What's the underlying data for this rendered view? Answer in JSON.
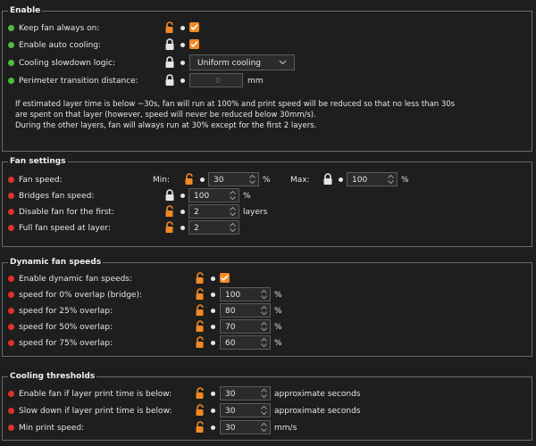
{
  "enable": {
    "title": "Enable",
    "keep_fan": {
      "label": "Keep fan always on:"
    },
    "auto_cooling": {
      "label": "Enable auto cooling:"
    },
    "slowdown": {
      "label": "Cooling slowdown logic:",
      "value": "Uniform cooling"
    },
    "perimeter": {
      "label": "Perimeter transition distance:",
      "value": "0",
      "unit": "mm"
    },
    "description": [
      "If estimated layer time is below ~30s, fan will run at 100% and print speed will be reduced so that no less than 30s",
      "are spent on that layer (however, speed will never be reduced below 30mm/s).",
      "During the other layers, fan will always run at 30% except for the first 2 layers."
    ]
  },
  "fan_settings": {
    "title": "Fan settings",
    "fan_speed": {
      "label": "Fan speed:",
      "min_label": "Min:",
      "min_value": "30",
      "min_unit": "%",
      "max_label": "Max:",
      "max_value": "100",
      "max_unit": "%"
    },
    "bridges": {
      "label": "Bridges fan speed:",
      "value": "100",
      "unit": "%"
    },
    "disable_first": {
      "label": "Disable fan for the first:",
      "value": "2",
      "unit": "layers"
    },
    "full_speed": {
      "label": "Full fan speed at layer:",
      "value": "2"
    }
  },
  "dynamic": {
    "title": "Dynamic fan speeds",
    "enable": {
      "label": "Enable dynamic fan speeds:"
    },
    "rows": [
      {
        "label": "speed for 0% overlap (bridge):",
        "value": "100",
        "unit": "%"
      },
      {
        "label": "speed for 25% overlap:",
        "value": "80",
        "unit": "%"
      },
      {
        "label": "speed for 50% overlap:",
        "value": "70",
        "unit": "%"
      },
      {
        "label": "speed for 75% overlap:",
        "value": "60",
        "unit": "%"
      }
    ]
  },
  "thresholds": {
    "title": "Cooling thresholds",
    "rows": [
      {
        "label": "Enable fan if layer print time is below:",
        "value": "30",
        "unit": "approximate seconds"
      },
      {
        "label": "Slow down if layer print time is below:",
        "value": "30",
        "unit": "approximate seconds"
      },
      {
        "label": "Min print speed:",
        "value": "30",
        "unit": "mm/s"
      }
    ]
  },
  "colors": {
    "accent": "#f08a24",
    "ok": "#4cbf3a",
    "modified": "#e0302a",
    "background": "#1e1e1e"
  }
}
